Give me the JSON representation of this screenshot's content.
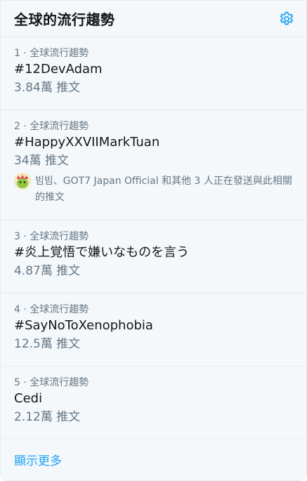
{
  "header": {
    "title": "全球的流行趨勢",
    "settings_icon": "gear-icon",
    "accent_color": "#1da1f2"
  },
  "trends": [
    {
      "meta": "1 · 全球流行趨勢",
      "name": "#12DevAdam",
      "count": "3.84萬 推文"
    },
    {
      "meta": "2 · 全球流行趨勢",
      "name": "#HappyXXVIIMarkTuan",
      "count": "34萬 推文",
      "context": {
        "avatar_icon": "bird-avatar-icon",
        "text": "빔빔、GOT7 Japan Official 和其他 3 人正在發送與此相關的推文"
      }
    },
    {
      "meta": "3 · 全球流行趨勢",
      "name": "#炎上覚悟で嫌いなものを言う",
      "count": "4.87萬 推文"
    },
    {
      "meta": "4 · 全球流行趨勢",
      "name": "#SayNoToXenophobia",
      "count": "12.5萬 推文"
    },
    {
      "meta": "5 · 全球流行趨勢",
      "name": "Cedi",
      "count": "2.12萬 推文"
    }
  ],
  "footer": {
    "show_more": "顯示更多"
  }
}
